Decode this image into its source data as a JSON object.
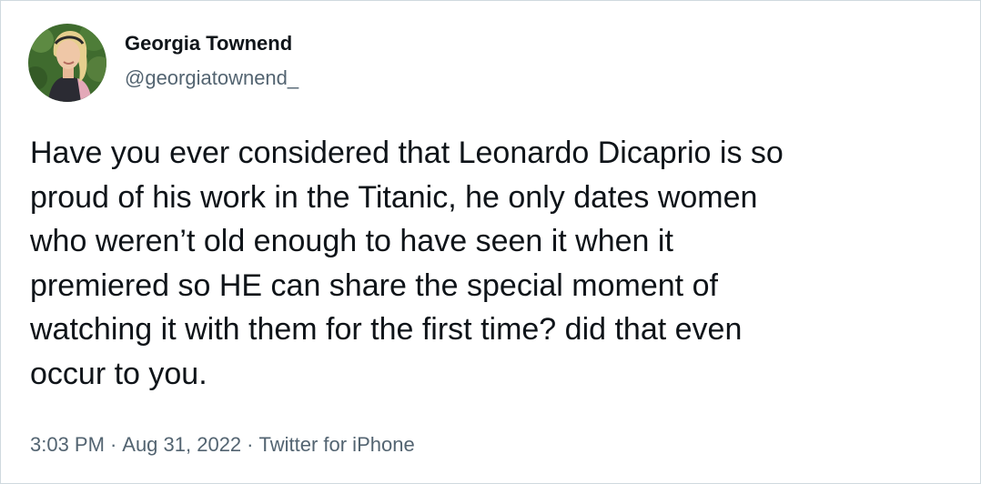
{
  "author": {
    "display_name": "Georgia Townend",
    "handle": "@georgiatownend_",
    "avatar_icon": "user-avatar-photo"
  },
  "tweet": {
    "lines": [
      "Have you ever considered that Leonardo Dicaprio is so",
      "proud of his work in the Titanic, he only dates women",
      "who weren’t old enough to have seen it when it",
      "premiered so HE can share the special moment of",
      "watching it with them for the first time? did that even",
      "occur to you."
    ]
  },
  "meta": {
    "time": "3:03 PM",
    "date": "Aug 31, 2022",
    "source": "Twitter for iPhone",
    "separator": "·"
  },
  "colors": {
    "text_primary": "#0f1419",
    "text_secondary": "#536471",
    "border": "#cfd9de"
  }
}
